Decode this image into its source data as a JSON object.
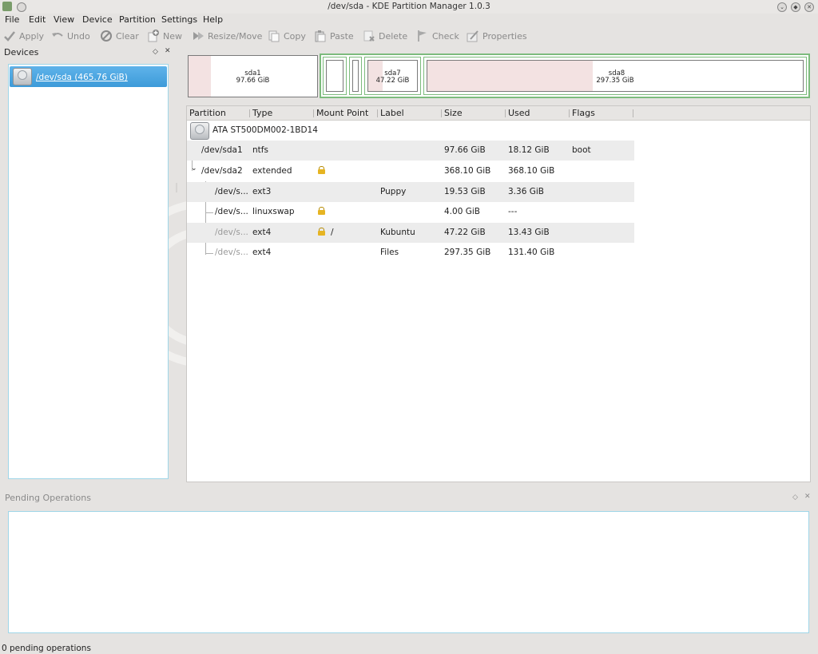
{
  "window": {
    "title": "/dev/sda - KDE Partition Manager 1.0.3"
  },
  "menu": [
    "File",
    "Edit",
    "View",
    "Device",
    "Partition",
    "Settings",
    "Help"
  ],
  "toolbar": [
    {
      "label": "Apply",
      "icon": "apply-check-icon"
    },
    {
      "label": "Undo",
      "icon": "undo-icon"
    },
    {
      "label": "Clear",
      "icon": "clear-icon"
    },
    {
      "label": "New",
      "icon": "new-partition-icon"
    },
    {
      "label": "Resize/Move",
      "icon": "resize-move-icon"
    },
    {
      "label": "Copy",
      "icon": "copy-icon"
    },
    {
      "label": "Paste",
      "icon": "paste-icon"
    },
    {
      "label": "Delete",
      "icon": "delete-icon"
    },
    {
      "label": "Check",
      "icon": "check-flag-icon"
    },
    {
      "label": "Properties",
      "icon": "properties-icon"
    }
  ],
  "devices": {
    "title": "Devices",
    "items": [
      {
        "label": "/dev/sda (465.76 GiB)"
      }
    ]
  },
  "map": {
    "sda1": {
      "name": "sda1",
      "size": "97.66 GiB"
    },
    "sda7": {
      "name": "sda7",
      "size": "47.22 GiB"
    },
    "sda8": {
      "name": "sda8",
      "size": "297.35 GiB"
    }
  },
  "table": {
    "columns": [
      "Partition",
      "Type",
      "Mount Point",
      "Label",
      "Size",
      "Used",
      "Flags"
    ],
    "disk": "ATA ST500DM002-1BD14",
    "rows": [
      {
        "partition": "/dev/sda1",
        "type": "ntfs",
        "mount": "",
        "label": "",
        "size": "97.66 GiB",
        "used": "18.12 GiB",
        "flags": "boot"
      },
      {
        "partition": "/dev/sda2",
        "type": "extended",
        "mount": "",
        "label": "",
        "size": "368.10 GiB",
        "used": "368.10 GiB",
        "flags": ""
      },
      {
        "partition": "/dev/s...",
        "type": "ext3",
        "mount": "",
        "label": "Puppy",
        "size": "19.53 GiB",
        "used": "3.36 GiB",
        "flags": ""
      },
      {
        "partition": "/dev/s...",
        "type": "linuxswap",
        "mount": "",
        "label": "",
        "size": "4.00 GiB",
        "used": "---",
        "flags": ""
      },
      {
        "partition": "/dev/s...",
        "type": "ext4",
        "mount": "/",
        "label": "Kubuntu",
        "size": "47.22 GiB",
        "used": "13.43 GiB",
        "flags": ""
      },
      {
        "partition": "/dev/s...",
        "type": "ext4",
        "mount": "",
        "label": "Files",
        "size": "297.35 GiB",
        "used": "131.40 GiB",
        "flags": ""
      }
    ]
  },
  "pending": {
    "title": "Pending Operations"
  },
  "status": "0 pending operations"
}
